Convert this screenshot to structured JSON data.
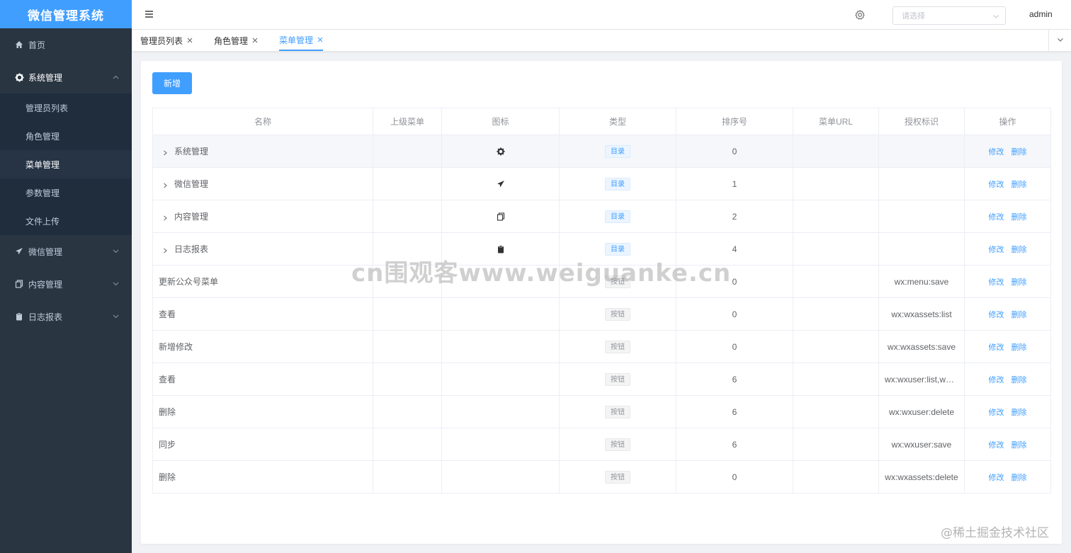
{
  "app": {
    "title": "微信管理系统"
  },
  "sidebar": {
    "home": "首页",
    "system": "系统管理",
    "system_items": [
      "管理员列表",
      "角色管理",
      "菜单管理",
      "参数管理",
      "文件上传"
    ],
    "wechat": "微信管理",
    "content": "内容管理",
    "log": "日志报表"
  },
  "header": {
    "select_placeholder": "请选择",
    "user": "admin"
  },
  "tabs": [
    "管理员列表",
    "角色管理",
    "菜单管理"
  ],
  "toolbar": {
    "add_label": "新增"
  },
  "table": {
    "columns": [
      "名称",
      "上级菜单",
      "图标",
      "类型",
      "排序号",
      "菜单URL",
      "授权标识",
      "操作"
    ],
    "rows": [
      {
        "name": "系统管理",
        "parent": "",
        "icon": "gear-icon",
        "type": "目录",
        "sort": "0",
        "url": "",
        "perm": "",
        "expandable": true
      },
      {
        "name": "微信管理",
        "parent": "",
        "icon": "paper-plane-icon",
        "type": "目录",
        "sort": "1",
        "url": "",
        "perm": "",
        "expandable": true
      },
      {
        "name": "内容管理",
        "parent": "",
        "icon": "copy-icon",
        "type": "目录",
        "sort": "2",
        "url": "",
        "perm": "",
        "expandable": true
      },
      {
        "name": "日志报表",
        "parent": "",
        "icon": "clipboard-icon",
        "type": "目录",
        "sort": "4",
        "url": "",
        "perm": "",
        "expandable": true
      },
      {
        "name": "更新公众号菜单",
        "parent": "",
        "icon": "",
        "type": "按钮",
        "sort": "0",
        "url": "",
        "perm": "wx:menu:save"
      },
      {
        "name": "查看",
        "parent": "",
        "icon": "",
        "type": "按钮",
        "sort": "0",
        "url": "",
        "perm": "wx:wxassets:list"
      },
      {
        "name": "新增修改",
        "parent": "",
        "icon": "",
        "type": "按钮",
        "sort": "0",
        "url": "",
        "perm": "wx:wxassets:save"
      },
      {
        "name": "查看",
        "parent": "",
        "icon": "",
        "type": "按钮",
        "sort": "6",
        "url": "",
        "perm": "wx:wxuser:list,wx:..."
      },
      {
        "name": "删除",
        "parent": "",
        "icon": "",
        "type": "按钮",
        "sort": "6",
        "url": "",
        "perm": "wx:wxuser:delete"
      },
      {
        "name": "同步",
        "parent": "",
        "icon": "",
        "type": "按钮",
        "sort": "6",
        "url": "",
        "perm": "wx:wxuser:save"
      },
      {
        "name": "删除",
        "parent": "",
        "icon": "",
        "type": "按钮",
        "sort": "0",
        "url": "",
        "perm": "wx:wxassets:delete"
      }
    ],
    "edit_label": "修改",
    "delete_label": "删除"
  },
  "watermark": "cn围观客www.weiguanke.cn",
  "footmark": "@稀土掘金技术社区",
  "colors": {
    "primary": "#409eff",
    "sidebar_bg": "#2a3542",
    "submenu_bg": "#1f2d3d"
  }
}
